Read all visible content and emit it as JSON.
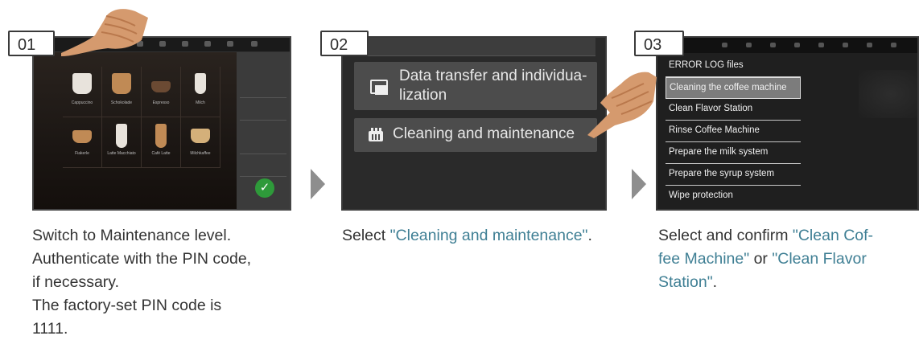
{
  "steps": [
    {
      "number": "01",
      "caption_lines": [
        "Switch to Maintenance level.",
        "Authenticate with the PIN code,",
        "if necessary.",
        "The factory-set PIN code is",
        "1111."
      ],
      "screen": {
        "drinks": [
          "Cappuccino",
          "Schokolade",
          "Espresso",
          "Milch",
          "Fiakerle",
          "Latte Macchiato",
          "Café Latte",
          "Milchkaffee"
        ],
        "confirm_icon": "check-icon"
      }
    },
    {
      "number": "02",
      "caption_prefix": "Select ",
      "caption_highlight": "\"Cleaning and maintenance\"",
      "caption_suffix": ".",
      "screen": {
        "item1_line1": "Data transfer and individua-",
        "item1_line2": "lization",
        "item2": "Cleaning and maintenance",
        "item1_icon": "data-transfer-icon",
        "item2_icon": "cleaning-icon"
      }
    },
    {
      "number": "03",
      "caption_line1_prefix": "Select and confirm ",
      "caption_line1_hl": "\"Clean Cof-",
      "caption_line2_hl": "fee Machine\"",
      "caption_line2_mid": " or ",
      "caption_line2_hl2": "\"Clean Flavor",
      "caption_line3_hl": "Station\"",
      "caption_line3_suffix": ".",
      "screen": {
        "menu": [
          "ERROR LOG files",
          "Cleaning the coffee machine",
          "Clean Flavor Station",
          "Rinse Coffee Machine",
          "Prepare the milk system",
          "Prepare the syrup system",
          "Wipe protection"
        ],
        "selected_index": 1
      }
    }
  ],
  "colors": {
    "highlight": "#3f7f94",
    "arrow": "#8e8e8e",
    "confirm": "#2e9a3a"
  },
  "icons": {
    "step_arrow": "chevron-right-icon",
    "pointer": "pointing-hand-icon"
  }
}
